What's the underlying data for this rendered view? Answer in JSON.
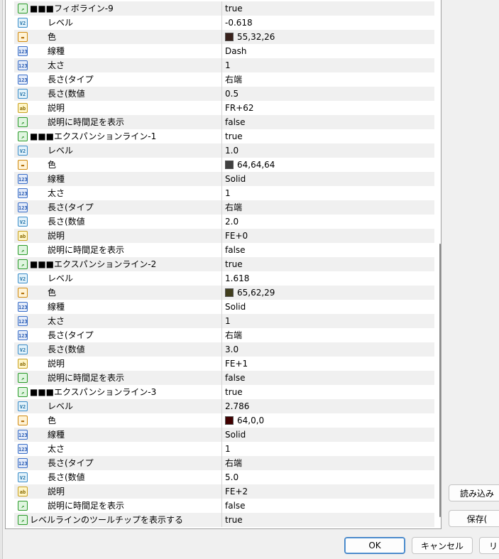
{
  "rows": [
    {
      "icon": "bool",
      "level": 0,
      "name": "■■■フィボライン-9",
      "value": "true"
    },
    {
      "icon": "dbl",
      "level": 1,
      "name": "レベル",
      "value": "-0.618"
    },
    {
      "icon": "color",
      "level": 1,
      "name": "色",
      "value": "55,32,26",
      "swatch": "#37201a"
    },
    {
      "icon": "int",
      "level": 1,
      "name": "線種",
      "value": "Dash"
    },
    {
      "icon": "int",
      "level": 1,
      "name": "太さ",
      "value": "1"
    },
    {
      "icon": "int",
      "level": 1,
      "name": "長さ(タイプ",
      "value": "右端"
    },
    {
      "icon": "dbl",
      "level": 1,
      "name": "長さ(数値",
      "value": "0.5"
    },
    {
      "icon": "str",
      "level": 1,
      "name": "説明",
      "value": "FR+62"
    },
    {
      "icon": "bool",
      "level": 1,
      "name": "説明に時間足を表示",
      "value": "false"
    },
    {
      "icon": "bool",
      "level": 0,
      "name": "■■■エクスパンションライン-1",
      "value": "true"
    },
    {
      "icon": "dbl",
      "level": 1,
      "name": "レベル",
      "value": "1.0"
    },
    {
      "icon": "color",
      "level": 1,
      "name": "色",
      "value": "64,64,64",
      "swatch": "#404040"
    },
    {
      "icon": "int",
      "level": 1,
      "name": "線種",
      "value": "Solid"
    },
    {
      "icon": "int",
      "level": 1,
      "name": "太さ",
      "value": "1"
    },
    {
      "icon": "int",
      "level": 1,
      "name": "長さ(タイプ",
      "value": "右端"
    },
    {
      "icon": "dbl",
      "level": 1,
      "name": "長さ(数値",
      "value": "2.0"
    },
    {
      "icon": "str",
      "level": 1,
      "name": "説明",
      "value": "FE+0"
    },
    {
      "icon": "bool",
      "level": 1,
      "name": "説明に時間足を表示",
      "value": "false"
    },
    {
      "icon": "bool",
      "level": 0,
      "name": "■■■エクスパンションライン-2",
      "value": "true"
    },
    {
      "icon": "dbl",
      "level": 1,
      "name": "レベル",
      "value": "1.618"
    },
    {
      "icon": "color",
      "level": 1,
      "name": "色",
      "value": "65,62,29",
      "swatch": "#413e1d"
    },
    {
      "icon": "int",
      "level": 1,
      "name": "線種",
      "value": "Solid"
    },
    {
      "icon": "int",
      "level": 1,
      "name": "太さ",
      "value": "1"
    },
    {
      "icon": "int",
      "level": 1,
      "name": "長さ(タイプ",
      "value": "右端"
    },
    {
      "icon": "dbl",
      "level": 1,
      "name": "長さ(数値",
      "value": "3.0"
    },
    {
      "icon": "str",
      "level": 1,
      "name": "説明",
      "value": "FE+1"
    },
    {
      "icon": "bool",
      "level": 1,
      "name": "説明に時間足を表示",
      "value": "false"
    },
    {
      "icon": "bool",
      "level": 0,
      "name": "■■■エクスパンションライン-3",
      "value": "true"
    },
    {
      "icon": "dbl",
      "level": 1,
      "name": "レベル",
      "value": "2.786"
    },
    {
      "icon": "color",
      "level": 1,
      "name": "色",
      "value": "64,0,0",
      "swatch": "#400000"
    },
    {
      "icon": "int",
      "level": 1,
      "name": "線種",
      "value": "Solid"
    },
    {
      "icon": "int",
      "level": 1,
      "name": "太さ",
      "value": "1"
    },
    {
      "icon": "int",
      "level": 1,
      "name": "長さ(タイプ",
      "value": "右端"
    },
    {
      "icon": "dbl",
      "level": 1,
      "name": "長さ(数値",
      "value": "5.0"
    },
    {
      "icon": "str",
      "level": 1,
      "name": "説明",
      "value": "FE+2"
    },
    {
      "icon": "bool",
      "level": 1,
      "name": "説明に時間足を表示",
      "value": "false"
    },
    {
      "icon": "bool",
      "level": 0,
      "name": "レベルラインのツールチップを表示する",
      "value": "true"
    }
  ],
  "icon_glyphs": {
    "bool": "↗",
    "dbl": "V2",
    "color": "▬",
    "int": "123",
    "str": "ab"
  },
  "icon_names": {
    "bool": "bool-param-icon",
    "dbl": "double-param-icon",
    "color": "color-param-icon",
    "int": "int-param-icon",
    "str": "string-param-icon"
  },
  "buttons": {
    "load": "読み込み",
    "save": "保存(",
    "ok": "OK",
    "cancel": "キャンセル",
    "reset": "リ"
  }
}
